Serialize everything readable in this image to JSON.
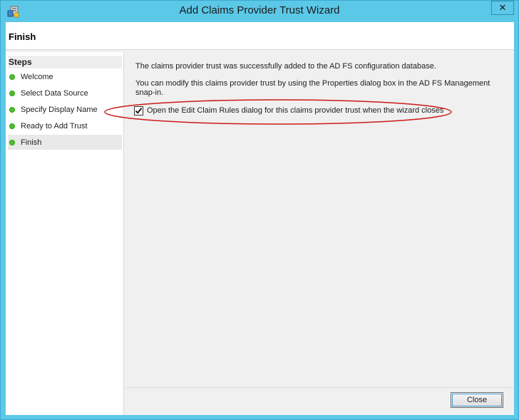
{
  "window": {
    "title": "Add Claims Provider Trust Wizard",
    "close_glyph": "✕",
    "accent_color": "#5cc8e8"
  },
  "header": {
    "page_title": "Finish"
  },
  "steps": {
    "heading": "Steps",
    "items": [
      {
        "label": "Welcome",
        "status": "complete"
      },
      {
        "label": "Select Data Source",
        "status": "complete"
      },
      {
        "label": "Specify Display Name",
        "status": "complete"
      },
      {
        "label": "Ready to Add Trust",
        "status": "complete"
      },
      {
        "label": "Finish",
        "status": "current"
      }
    ],
    "status_color": "#4bc02f"
  },
  "content": {
    "success_message": "The claims provider trust was successfully added to the AD FS configuration database.",
    "info_message": "You can modify this claims provider trust by using the Properties dialog box in the AD FS Management snap-in.",
    "checkbox": {
      "label": "Open the Edit Claim Rules dialog for this claims provider trust when the wizard closes",
      "checked": true
    },
    "highlight_color": "#cc1a1a"
  },
  "footer": {
    "close_label": "Close"
  }
}
